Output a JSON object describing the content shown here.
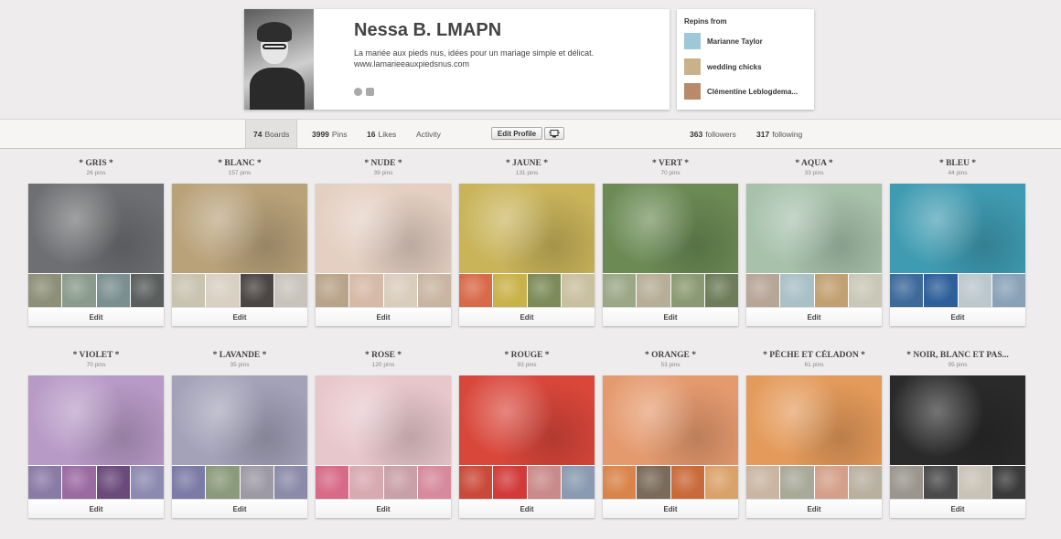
{
  "profile": {
    "name": "Nessa B. LMAPN",
    "bio": "La mariée aux pieds nus, idées pour un mariage simple et délicat.",
    "url": "www.lamarieeauxpiedsnus.com",
    "icons": [
      "globe-icon",
      "facebook-icon"
    ]
  },
  "repins": {
    "title": "Repins from",
    "items": [
      {
        "name": "Marianne Taylor",
        "color": "#9cc8d8"
      },
      {
        "name": "wedding chicks",
        "color": "#c9b28a"
      },
      {
        "name": "Clémentine Leblogdema...",
        "color": "#b88a6a"
      }
    ]
  },
  "stats": {
    "boards_count": "74",
    "boards_label": "Boards",
    "pins_count": "3999",
    "pins_label": "Pins",
    "likes_count": "16",
    "likes_label": "Likes",
    "activity_label": "Activity",
    "edit_profile_label": "Edit Profile",
    "followers_count": "363",
    "followers_label": "followers",
    "following_count": "317",
    "following_label": "following"
  },
  "boards": [
    {
      "title": "* GRIS *",
      "pins": "26 pins",
      "edit": "Edit",
      "cover": "#6e6f72",
      "thumbs": [
        "#8d8f78",
        "#8a9b8c",
        "#7b8f90",
        "#5a5e5c"
      ]
    },
    {
      "title": "* BLANC *",
      "pins": "157 pins",
      "edit": "Edit",
      "cover": "#b9a27a",
      "thumbs": [
        "#c9c3b0",
        "#d9cfc3",
        "#4b4644",
        "#c8c4bc"
      ]
    },
    {
      "title": "* NUDE *",
      "pins": "39 pins",
      "edit": "Edit",
      "cover": "#e4cfc2",
      "thumbs": [
        "#b9a48a",
        "#d6b9a6",
        "#d9cdbd",
        "#c9b6a2"
      ]
    },
    {
      "title": "* JAUNE *",
      "pins": "131 pins",
      "edit": "Edit",
      "cover": "#c9b45a",
      "thumbs": [
        "#d86a4a",
        "#c9b24a",
        "#7d8a5a",
        "#c9c0a0"
      ]
    },
    {
      "title": "* VERT *",
      "pins": "70 pins",
      "edit": "Edit",
      "cover": "#6b8a54",
      "thumbs": [
        "#9aa886",
        "#b6ae96",
        "#8b9a72",
        "#6d7d5a"
      ]
    },
    {
      "title": "* AQUA *",
      "pins": "33 pins",
      "edit": "Edit",
      "cover": "#a7c1ab",
      "thumbs": [
        "#b7a596",
        "#a9c0c6",
        "#c2a072",
        "#c9c8b8"
      ]
    },
    {
      "title": "* BLEU *",
      "pins": "44 pins",
      "edit": "Edit",
      "cover": "#3f9bb1",
      "thumbs": [
        "#3e6a9a",
        "#2e5f9a",
        "#bcc8cc",
        "#8aa2b8"
      ]
    },
    {
      "title": "* VIOLET *",
      "pins": "70 pins",
      "edit": "Edit",
      "cover": "#b79ac6",
      "thumbs": [
        "#8a7aa6",
        "#9a6aa0",
        "#6a4a7a",
        "#8c8ab0"
      ]
    },
    {
      "title": "* LAVANDE *",
      "pins": "35 pins",
      "edit": "Edit",
      "cover": "#a3a2b8",
      "thumbs": [
        "#7c7aa6",
        "#8a9a7a",
        "#9d9aa6",
        "#8b8aa8"
      ]
    },
    {
      "title": "* ROSE *",
      "pins": "120 pins",
      "edit": "Edit",
      "cover": "#e8c7cc",
      "thumbs": [
        "#d76a86",
        "#d7a9b0",
        "#c9a0a8",
        "#d68a9c"
      ]
    },
    {
      "title": "* ROUGE *",
      "pins": "93 pins",
      "edit": "Edit",
      "cover": "#d9463a",
      "thumbs": [
        "#c94a3a",
        "#d23a3a",
        "#c98a8a",
        "#8a9ab0"
      ]
    },
    {
      "title": "* ORANGE *",
      "pins": "53 pins",
      "edit": "Edit",
      "cover": "#e59a6e",
      "thumbs": [
        "#d9844a",
        "#7a6a5a",
        "#c96a3a",
        "#d9a26a"
      ]
    },
    {
      "title": "* PÊCHE ET CÉLADON *",
      "pins": "61 pins",
      "edit": "Edit",
      "cover": "#e49a5a",
      "thumbs": [
        "#c9b6a2",
        "#a9a99a",
        "#d4a08a",
        "#b9b0a0"
      ]
    },
    {
      "title": "* NOIR, BLANC ET PAS...",
      "pins": "95 pins",
      "edit": "Edit",
      "cover": "#2a2a2a",
      "thumbs": [
        "#9a968e",
        "#4a4a4a",
        "#c9c2b6",
        "#3a3a3a"
      ]
    }
  ]
}
